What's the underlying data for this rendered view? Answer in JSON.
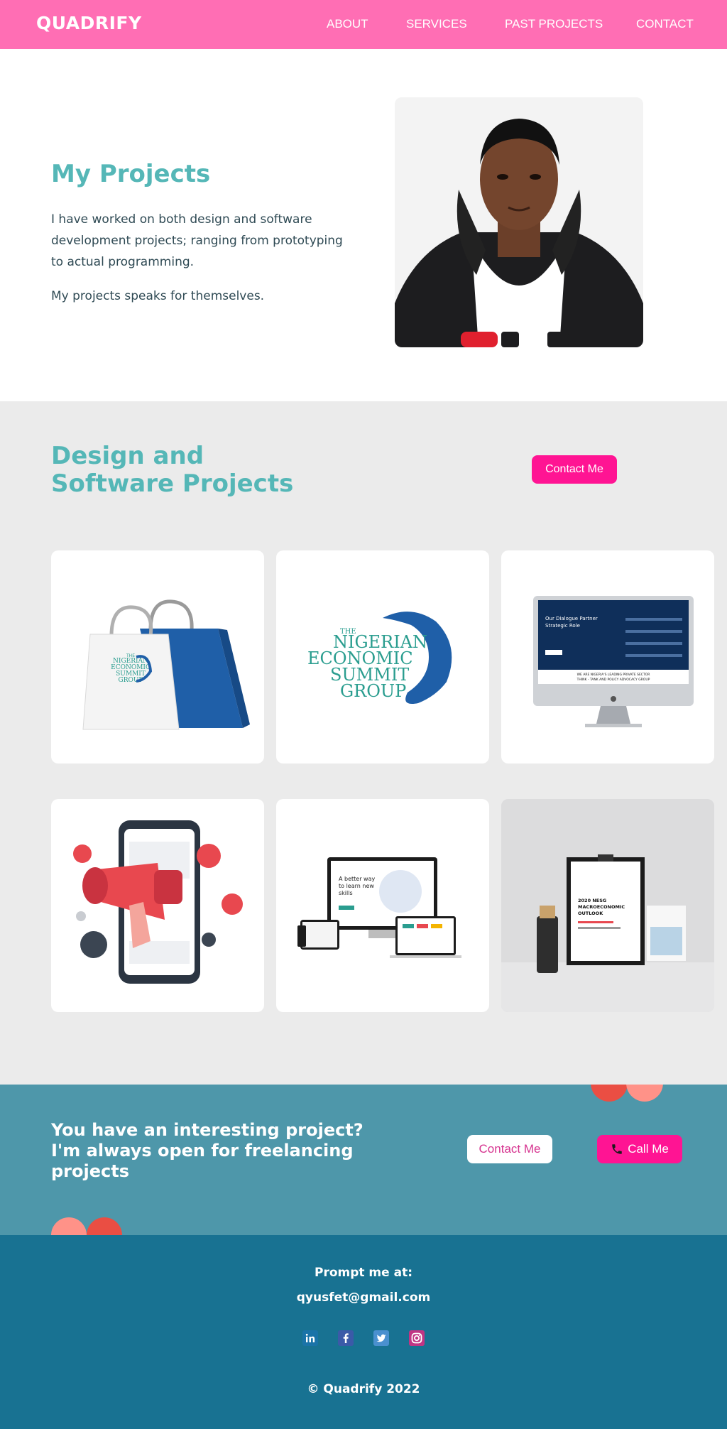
{
  "nav": {
    "brand": "QUADRIFY",
    "links": [
      "ABOUT",
      "SERVICES",
      "PAST PROJECTS",
      "CONTACT"
    ]
  },
  "hero": {
    "title": "My Projects",
    "paragraph1": "I have worked on both design and software development projects; ranging from prototyping to actual programming.",
    "paragraph2": "My projects speaks for themselves."
  },
  "projects": {
    "title_line1": "Design and",
    "title_line2": "Software Projects",
    "contact_button": "Contact Me",
    "logo_small": [
      "THE",
      "NIGERIAN",
      "ECONOMIC",
      "SUMMIT",
      "GROUP"
    ],
    "logo_big": [
      "THE",
      "NIGERIAN",
      "ECONOMIC",
      "SUMMIT",
      "GROUP"
    ],
    "monitor_heading": [
      "Our Dialogue Partner",
      "Strategic Role"
    ],
    "monitor_caption": [
      "WE ARE NIGERIA'S LEADING PRIVATE SECTOR",
      "THINK - TANK AND POLICY ADVOCACY GROUP"
    ],
    "devices_heading": [
      "A better way",
      "to learn new",
      "skills"
    ],
    "poster_title": [
      "2020 NESG",
      "MACROECONOMIC",
      "OUTLOOK"
    ]
  },
  "cta": {
    "text_line1": "You have an interesting project?",
    "text_line2": "I'm always open for freelancing",
    "text_line3": "projects",
    "contact_button": "Contact Me",
    "call_button": "Call Me"
  },
  "footer": {
    "prompt": "Prompt me at:",
    "email": "qyusfet@gmail.com",
    "copyright": "© Quadrify 2022"
  },
  "colors": {
    "nav": "#ff6eb4",
    "accent_teal": "#55b7b7",
    "pink_button": "#ff1493",
    "cta_bg": "#4e97aa",
    "footer_bg": "#187292"
  }
}
